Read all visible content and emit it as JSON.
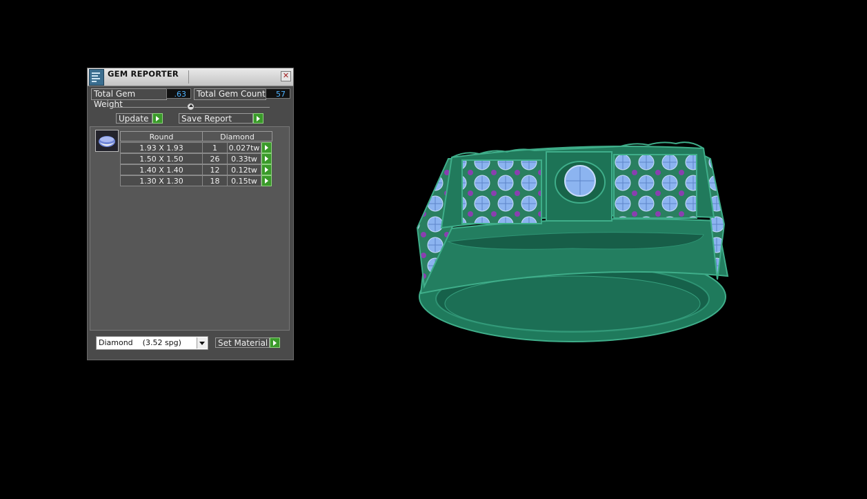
{
  "window": {
    "title": "GEM REPORTER",
    "close_label": "✕"
  },
  "totals": {
    "weight_label": "Total Gem Weight",
    "weight_value": ".63",
    "count_label": "Total Gem Count",
    "count_value": "57"
  },
  "buttons": {
    "update": "Update",
    "save_report": "Save Report",
    "set_material": "Set Material"
  },
  "table": {
    "headers": [
      "Round",
      "Diamond"
    ],
    "rows": [
      {
        "size": "1.93 X 1.93",
        "count": "1",
        "weight": "0.027tw"
      },
      {
        "size": "1.50 X 1.50",
        "count": "26",
        "weight": "0.33tw"
      },
      {
        "size": "1.40 X 1.40",
        "count": "12",
        "weight": "0.12tw"
      },
      {
        "size": "1.30 X 1.30",
        "count": "18",
        "weight": "0.15tw"
      }
    ]
  },
  "material": {
    "name": "Diamond",
    "spg": "(3.52 spg)"
  },
  "colors": {
    "ring_green": "#1f7a5c",
    "gem_blue": "#8cb4f0",
    "gem_purple": "#8a3fb0",
    "value_text": "#4fb3ff",
    "go_button": "#3a9a2a"
  }
}
